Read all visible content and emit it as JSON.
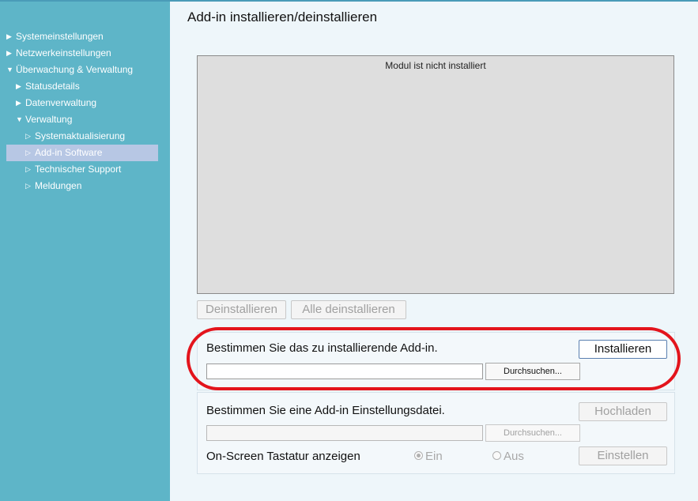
{
  "page_title": "Add-in installieren/deinstallieren",
  "sidebar": {
    "items": [
      {
        "label": "Systemeinstellungen",
        "arrow": "▶"
      },
      {
        "label": "Netzwerkeinstellungen",
        "arrow": "▶"
      },
      {
        "label": "Überwachung & Verwaltung",
        "arrow": "▼"
      },
      {
        "label": "Statusdetails",
        "arrow": "▶"
      },
      {
        "label": "Datenverwaltung",
        "arrow": "▶"
      },
      {
        "label": "Verwaltung",
        "arrow": "▼"
      },
      {
        "label": "Systemaktualisierung",
        "arrow": "▷"
      },
      {
        "label": "Add-in Software",
        "arrow": "▷"
      },
      {
        "label": "Technischer Support",
        "arrow": "▷"
      },
      {
        "label": "Meldungen",
        "arrow": "▷"
      }
    ]
  },
  "module_list": {
    "empty_message": "Modul ist nicht installiert"
  },
  "buttons": {
    "uninstall": "Deinstallieren",
    "uninstall_all": "Alle deinstallieren"
  },
  "install_section": {
    "label": "Bestimmen Sie das zu installierende Add-in.",
    "install_button": "Installieren",
    "browse_button": "Durchsuchen...",
    "file_value": ""
  },
  "settings_section": {
    "label": "Bestimmen Sie eine Add-in Einstellungsdatei.",
    "upload_button": "Hochladen",
    "browse_button": "Durchsuchen...",
    "file_value": "",
    "keyboard_label": "On-Screen Tastatur anzeigen",
    "radio_on": "Ein",
    "radio_off": "Aus",
    "set_button": "Einstellen"
  },
  "colors": {
    "sidebar_bg": "#5eb5c8",
    "selected_item_bg": "#b7c7e4",
    "highlight_ring": "#e3141c",
    "main_bg": "#eef6fa"
  }
}
